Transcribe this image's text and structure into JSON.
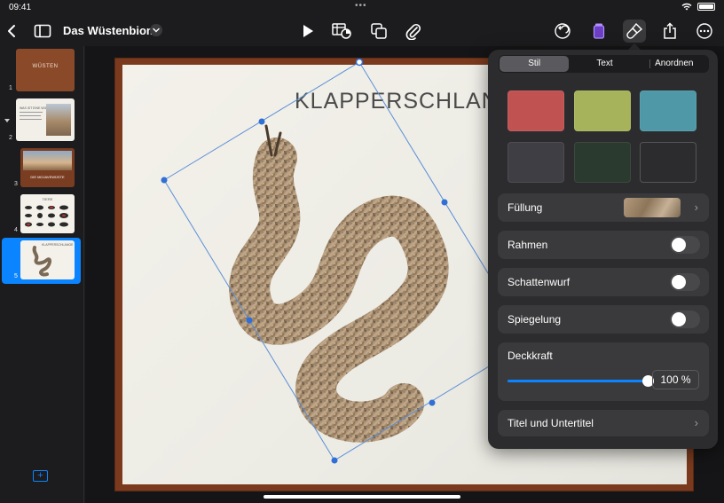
{
  "status": {
    "time": "09:41",
    "center_dots": "•••"
  },
  "toolbar": {
    "doc_title": "Das Wüstenbiom"
  },
  "sidebar": {
    "slides": [
      {
        "number": "1",
        "caption": "WÜSTEN"
      },
      {
        "number": "2",
        "caption": "WAS IST EINE WÜSTE?"
      },
      {
        "number": "3",
        "caption": "DIE MOJAVEWÜSTE"
      },
      {
        "number": "4",
        "caption": "TIERE"
      },
      {
        "number": "5",
        "caption": "KLAPPERSCHLANGE"
      }
    ],
    "selected_slide": 5
  },
  "slide": {
    "title": "KLAPPERSCHLANGE"
  },
  "panel": {
    "tabs": [
      "Stil",
      "Text",
      "Anordnen"
    ],
    "active_tab": "Stil",
    "swatch_colors": [
      "#c05252",
      "#a6b35a",
      "#4e98a8",
      "#3e3e44",
      "#2b3a2e",
      "#2c2c2e"
    ],
    "fill_label": "Füllung",
    "border_label": "Rahmen",
    "shadow_label": "Schattenwurf",
    "reflection_label": "Spiegelung",
    "opacity_label": "Deckkraft",
    "opacity_value": "100 %",
    "opacity_fraction": 1.0,
    "caption_label": "Titel und Untertitel"
  },
  "colors": {
    "accent": "#0a84ff",
    "panel_bg": "#2c2c2e",
    "slide_frame": "#7b3a1e"
  }
}
